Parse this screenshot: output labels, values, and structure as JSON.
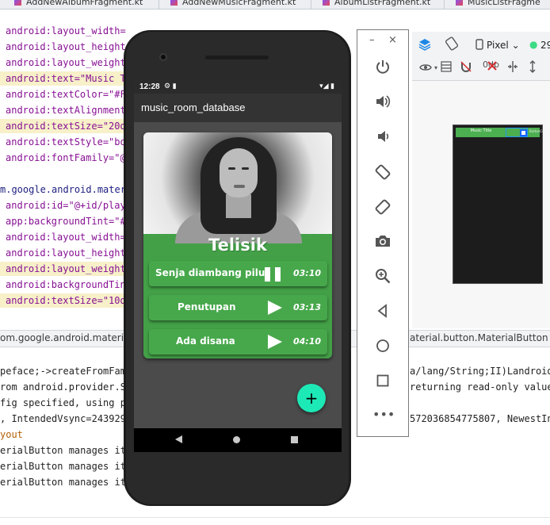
{
  "ide": {
    "tabs": [
      "AddNewAlbumFragment.kt",
      "AddNewMusicFragment.kt",
      "AlbumListFragment.kt",
      "MusicListFragme"
    ],
    "code_lines": [
      {
        "text": "android:layout_width=\"",
        "hl": false
      },
      {
        "text": "android:layout_height",
        "hl": false
      },
      {
        "text": "android:layout_weight=",
        "hl": false
      },
      {
        "text": "android:text=\"Music Ti",
        "hl": true
      },
      {
        "text": "android:textColor=\"#F",
        "hl": false
      },
      {
        "text": "android:textAlignment=",
        "hl": false
      },
      {
        "text": "android:textSize=\"20dp",
        "hl": true
      },
      {
        "text": "android:textStyle=\"bol",
        "hl": false
      },
      {
        "text": "android:fontFamily=\"@f",
        "hl": false
      },
      {
        "text": "",
        "hl": false
      },
      {
        "text": "m.google.android.mater",
        "hl": false
      },
      {
        "text": "android:id=\"@+id/playB",
        "hl": false
      },
      {
        "text": "app:backgroundTint=\"#",
        "hl": false
      },
      {
        "text": "android:layout_width=\"",
        "hl": false
      },
      {
        "text": "android:layout_height",
        "hl": false
      },
      {
        "text": "android:layout_weight=",
        "hl": true
      },
      {
        "text": "android:backgroundTint",
        "hl": false
      },
      {
        "text": "android:textSize=\"10dp",
        "hl": true
      }
    ],
    "breadcrumb_left": "om.google.android.material.c",
    "breadcrumb_right": "aterial.button.MaterialButton",
    "log_lines_left": [
      "peface;->createFromFami",
      "rom android.provider.Se",
      "fig specified, using pi",
      ", IntendedVsync=2439295",
      "yout",
      "erialButton manages its",
      "erialButton manages its",
      "erialButton manages its"
    ],
    "log_lines_right": [
      "a/lang/String;II)Landroid/g",
      "returning read-only value",
      "",
      "572036854775807, NewestInpu",
      "",
      "",
      "",
      ""
    ],
    "design": {
      "device": "Pixel",
      "api": "29",
      "blueprint_title": "Music Title",
      "blueprint_button": "ButtonCu"
    }
  },
  "emulator": {
    "status_time": "12:28",
    "app_title": "music_room_database",
    "album_title": "Telisik",
    "songs": [
      {
        "name": "Senja diambang pilu",
        "duration": "03:10",
        "state": "pause"
      },
      {
        "name": "Penutupan",
        "duration": "03:13",
        "state": "play"
      },
      {
        "name": "Ada disana",
        "duration": "04:10",
        "state": "play"
      }
    ],
    "fab_label": "+",
    "accent_color": "#43a047",
    "fab_color": "#1de9b6"
  },
  "side_panel": {
    "controls": [
      "power-icon",
      "volume-up-icon",
      "volume-down-icon",
      "rotate-left-icon",
      "rotate-right-icon",
      "camera-icon",
      "zoom-icon",
      "back-icon",
      "home-icon",
      "overview-icon",
      "more-icon"
    ]
  }
}
